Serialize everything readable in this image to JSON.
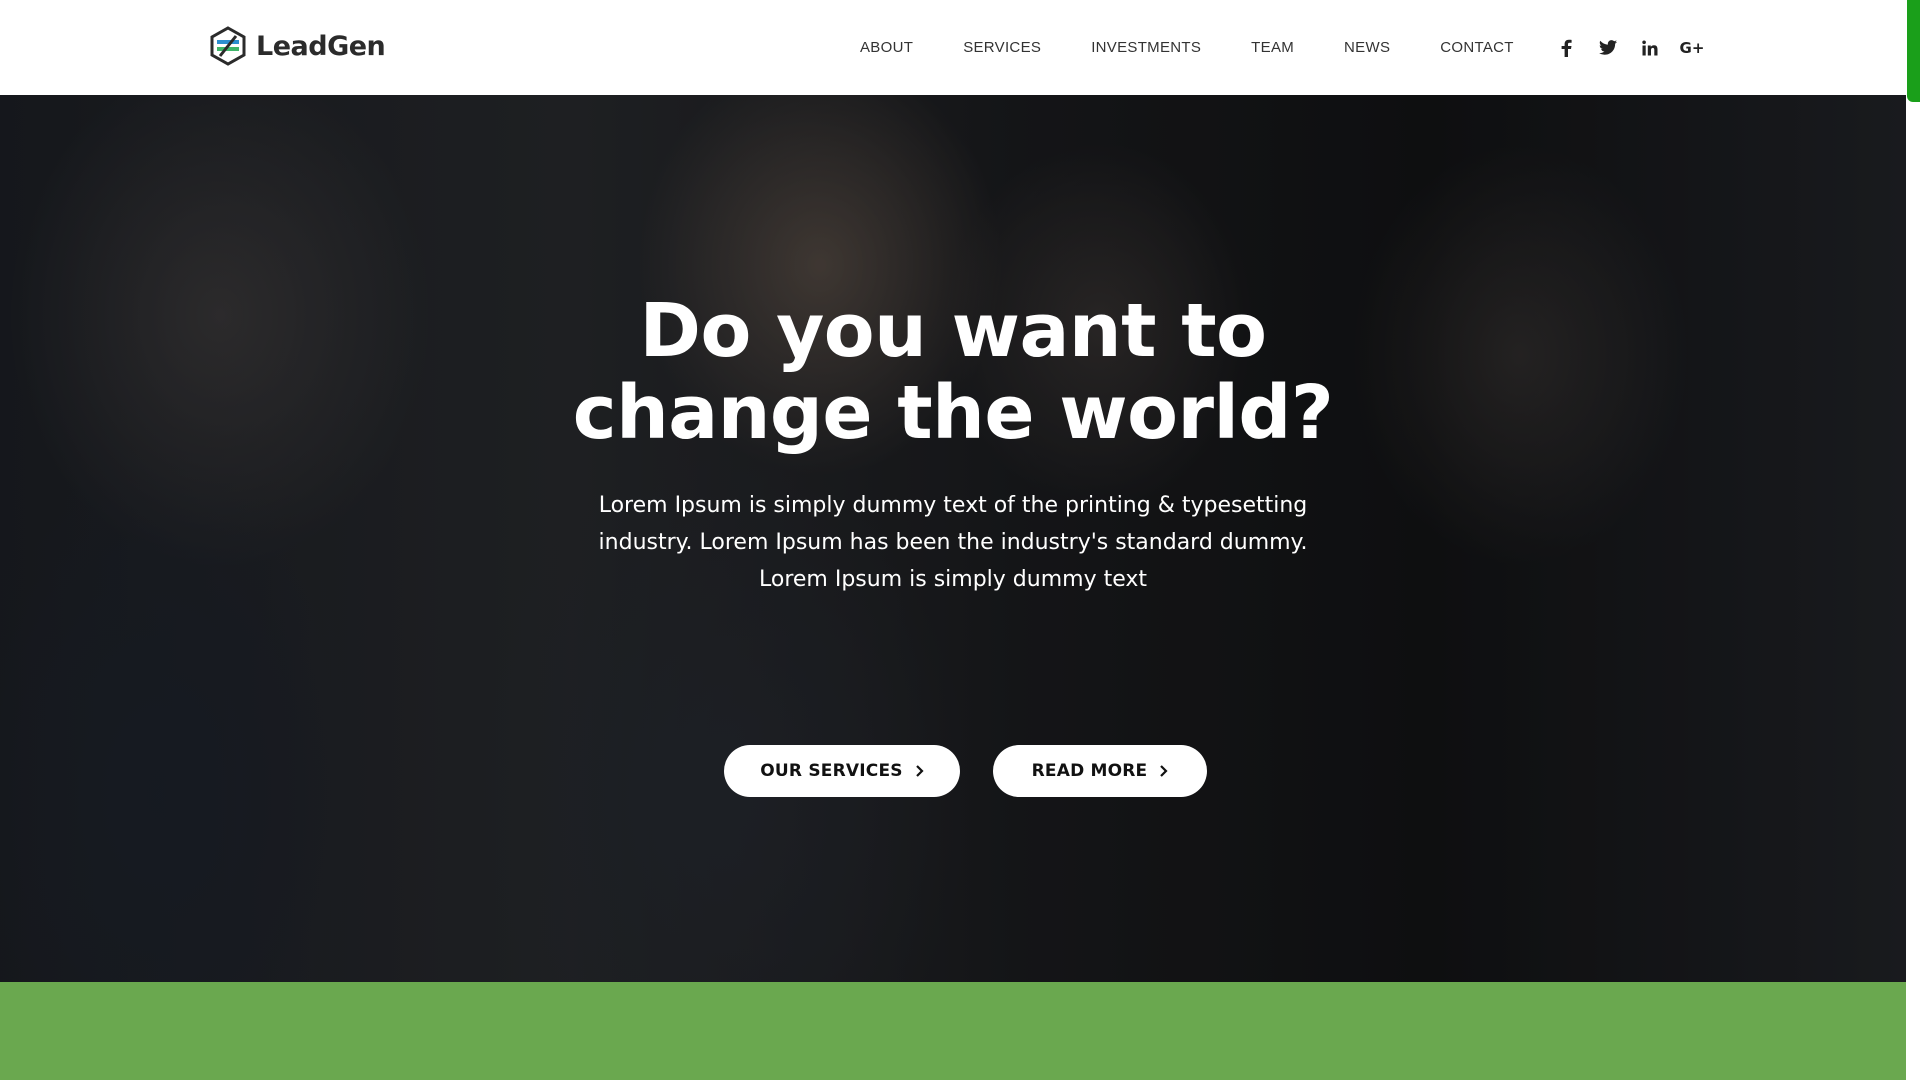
{
  "header": {
    "logo_text": "LeadGen",
    "nav": [
      "ABOUT",
      "SERVICES",
      "INVESTMENTS",
      "TEAM",
      "NEWS",
      "CONTACT"
    ],
    "social": [
      {
        "name": "facebook-icon"
      },
      {
        "name": "twitter-icon"
      },
      {
        "name": "linkedin-icon"
      },
      {
        "name": "google-plus-icon",
        "glyph": "G+"
      }
    ]
  },
  "hero": {
    "title_line1": "Do you want to",
    "title_line2": "change the world?",
    "text_line1": "Lorem Ipsum is simply dummy text of the printing & typesetting",
    "text_line2": "industry. Lorem Ipsum has been the industry's standard dummy.",
    "text_line3": "Lorem Ipsum is simply dummy text",
    "buttons": {
      "services": "OUR SERVICES",
      "read_more": "READ MORE"
    }
  },
  "colors": {
    "accent_green": "#6aa84f",
    "scrollbar": "#1a9f1a",
    "header_bg": "#ffffff",
    "text_dark": "#333333"
  },
  "icons": {
    "logo": "hexagon-logo-icon",
    "button_arrow": "chevron-right-icon"
  }
}
